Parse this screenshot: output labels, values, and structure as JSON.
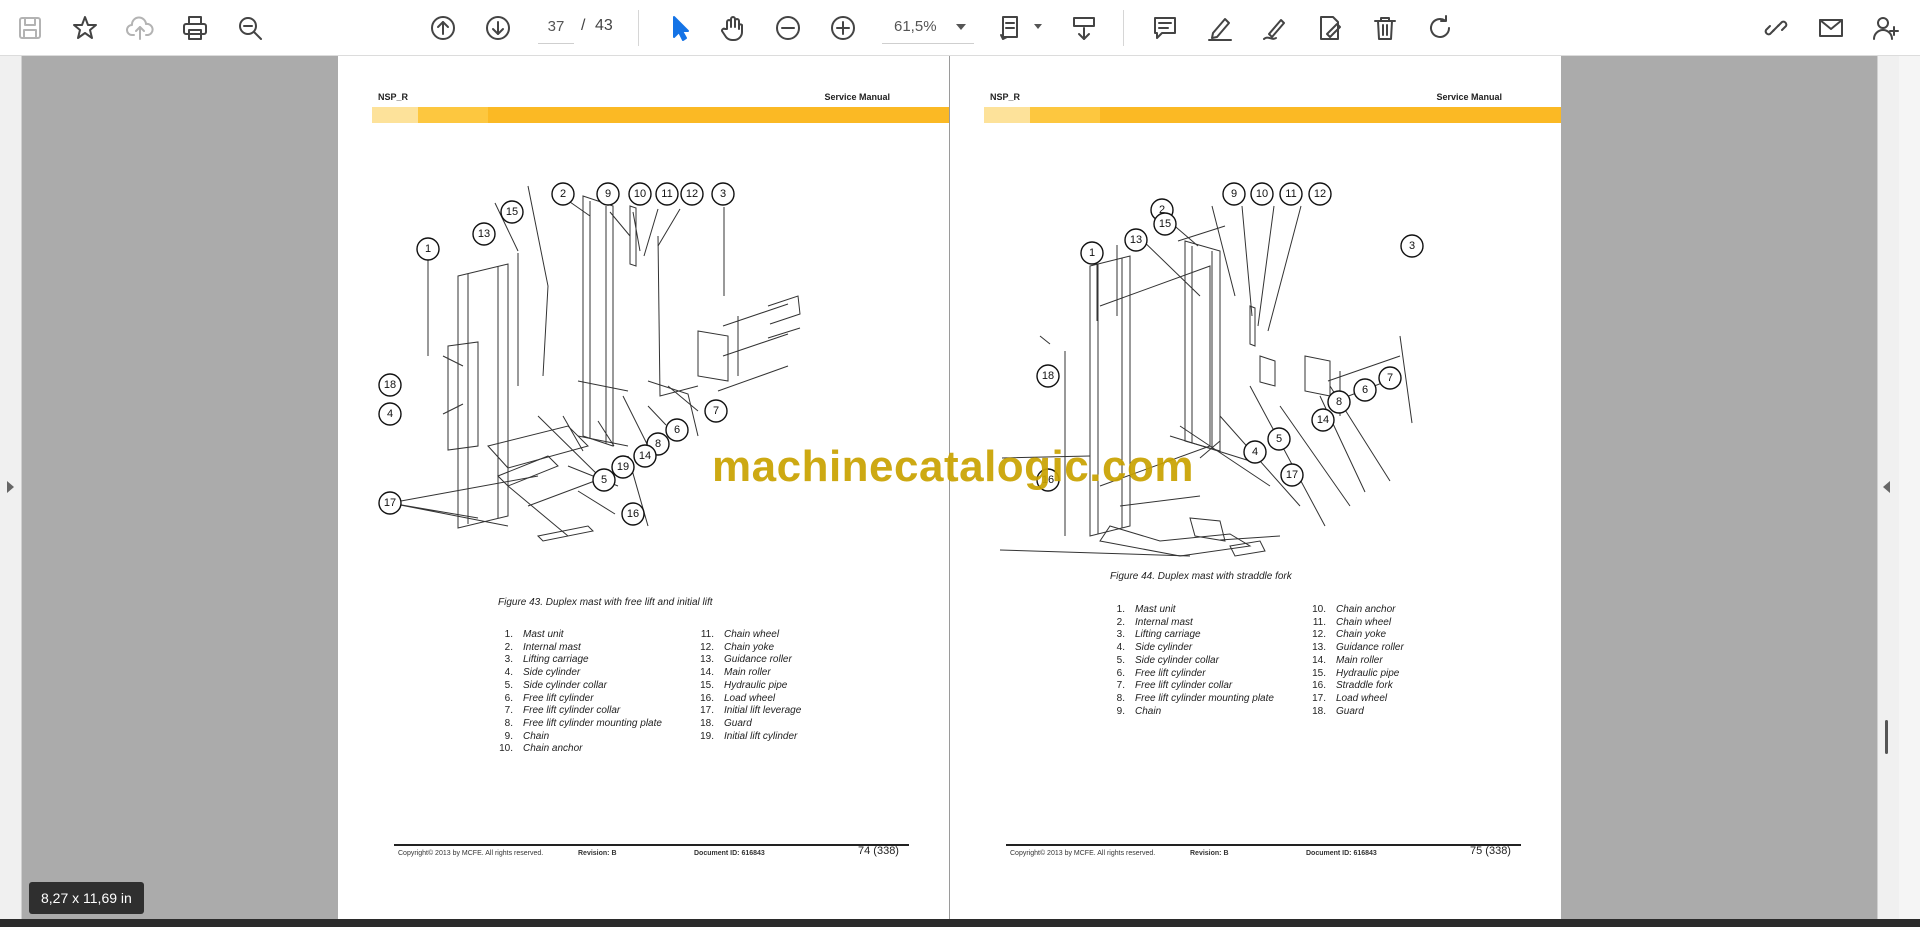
{
  "toolbar": {
    "page_current": "37",
    "page_separator": "/",
    "page_total": "43",
    "zoom_value": "61,5%"
  },
  "left_page": {
    "header_left": "NSP_R",
    "header_right": "Service Manual",
    "figure_caption": "Figure 43. Duplex mast with free lift and initial lift",
    "callouts": [
      "1",
      "2",
      "3",
      "4",
      "5",
      "6",
      "7",
      "8",
      "9",
      "10",
      "11",
      "12",
      "13",
      "14",
      "15",
      "16",
      "17",
      "18",
      "19"
    ],
    "parts_col1": [
      {
        "num": "1.",
        "label": "Mast unit"
      },
      {
        "num": "2.",
        "label": "Internal mast"
      },
      {
        "num": "3.",
        "label": "Lifting carriage"
      },
      {
        "num": "4.",
        "label": "Side cylinder"
      },
      {
        "num": "5.",
        "label": "Side cylinder collar"
      },
      {
        "num": "6.",
        "label": "Free lift cylinder"
      },
      {
        "num": "7.",
        "label": "Free lift cylinder collar"
      },
      {
        "num": "8.",
        "label": "Free lift cylinder mounting plate"
      },
      {
        "num": "9.",
        "label": "Chain"
      },
      {
        "num": "10.",
        "label": "Chain anchor"
      }
    ],
    "parts_col2": [
      {
        "num": "11.",
        "label": "Chain wheel"
      },
      {
        "num": "12.",
        "label": "Chain yoke"
      },
      {
        "num": "13.",
        "label": "Guidance roller"
      },
      {
        "num": "14.",
        "label": "Main roller"
      },
      {
        "num": "15.",
        "label": "Hydraulic pipe"
      },
      {
        "num": "16.",
        "label": "Load wheel"
      },
      {
        "num": "17.",
        "label": "Initial lift leverage"
      },
      {
        "num": "18.",
        "label": "Guard"
      },
      {
        "num": "19.",
        "label": "Initial lift cylinder"
      }
    ],
    "footer_copyright": "Copyright© 2013 by MCFE. All rights reserved.",
    "footer_revision": "Revision: B",
    "footer_document": "Document ID: 616843",
    "page_number": "74 (338)"
  },
  "right_page": {
    "header_left": "NSP_R",
    "header_right": "Service Manual",
    "figure_caption": "Figure 44. Duplex mast with straddle fork",
    "callouts": [
      "1",
      "2",
      "3",
      "4",
      "5",
      "6",
      "7",
      "8",
      "9",
      "10",
      "11",
      "12",
      "13",
      "14",
      "15",
      "16",
      "17",
      "18"
    ],
    "parts_col1": [
      {
        "num": "1.",
        "label": "Mast unit"
      },
      {
        "num": "2.",
        "label": "Internal mast"
      },
      {
        "num": "3.",
        "label": "Lifting carriage"
      },
      {
        "num": "4.",
        "label": "Side cylinder"
      },
      {
        "num": "5.",
        "label": "Side cylinder collar"
      },
      {
        "num": "6.",
        "label": "Free lift cylinder"
      },
      {
        "num": "7.",
        "label": "Free lift cylinder collar"
      },
      {
        "num": "8.",
        "label": "Free lift cylinder mounting plate"
      },
      {
        "num": "9.",
        "label": "Chain"
      }
    ],
    "parts_col2": [
      {
        "num": "10.",
        "label": "Chain anchor"
      },
      {
        "num": "11.",
        "label": "Chain wheel"
      },
      {
        "num": "12.",
        "label": "Chain yoke"
      },
      {
        "num": "13.",
        "label": "Guidance roller"
      },
      {
        "num": "14.",
        "label": "Main roller"
      },
      {
        "num": "15.",
        "label": "Hydraulic pipe"
      },
      {
        "num": "16.",
        "label": "Straddle fork"
      },
      {
        "num": "17.",
        "label": "Load wheel"
      },
      {
        "num": "18.",
        "label": "Guard"
      }
    ],
    "footer_copyright": "Copyright© 2013 by MCFE. All rights reserved.",
    "footer_revision": "Revision: B",
    "footer_document": "Document ID: 616843",
    "page_number": "75 (338)"
  },
  "watermark": "machinecatalogic.com",
  "page_size_label": "8,27 x 11,69 in",
  "colors": {
    "accent": "#1473e6",
    "header_bar": "#fbb924",
    "watermark": "#c9a200"
  }
}
